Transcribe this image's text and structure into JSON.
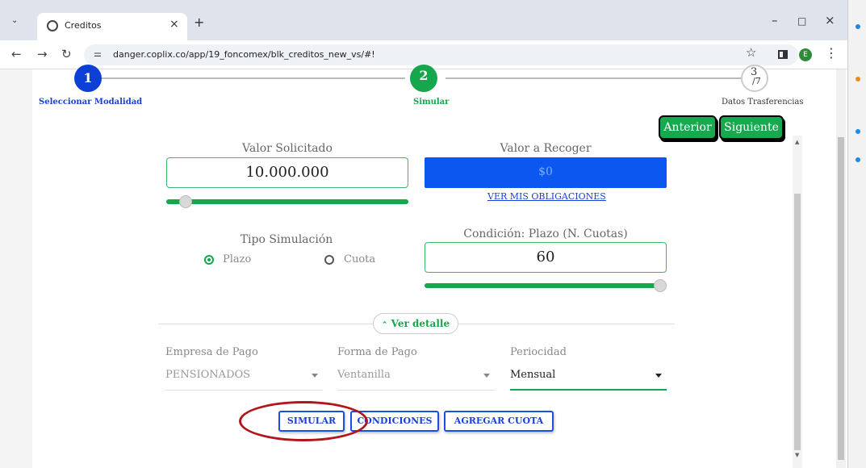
{
  "browser": {
    "tab_title": "Creditos",
    "url": "danger.coplix.co/app/19_foncomex/blk_creditos_new_vs/#!",
    "profile_initial": "E"
  },
  "stepper": {
    "steps": [
      {
        "number": "1",
        "label": "Seleccionar Modalidad",
        "state": "done",
        "color": "#0b3fd6"
      },
      {
        "number": "2",
        "label": "Simular",
        "state": "active",
        "color": "#16a64c"
      },
      {
        "number": "3",
        "total": "/7",
        "label": "Datos Trasferencias",
        "state": "pending"
      }
    ]
  },
  "nav": {
    "anterior": "Anterior",
    "siguiente": "Siguiente"
  },
  "form": {
    "valor_solicitado": {
      "label": "Valor Solicitado",
      "value": "10.000.000",
      "slider_fraction": 0.08
    },
    "valor_recoger": {
      "label": "Valor a Recoger",
      "value": "$0",
      "link": "VER MIS OBLIGACIONES"
    },
    "tipo_simulacion": {
      "label": "Tipo Simulación",
      "options": [
        "Plazo",
        "Cuota"
      ],
      "selected": "Plazo"
    },
    "condicion_plazo": {
      "label": "Condición: Plazo (N. Cuotas)",
      "value": "60",
      "slider_fraction": 1.0
    },
    "ver_detalle": "Ver detalle",
    "empresa_pago": {
      "label": "Empresa de Pago",
      "value": "PENSIONADOS"
    },
    "forma_pago": {
      "label": "Forma de Pago",
      "value": "Ventanilla"
    },
    "periodicidad": {
      "label": "Periocidad",
      "value": "Mensual"
    }
  },
  "actions": {
    "simular": "SIMULAR",
    "condiciones": "CONDICIONES",
    "agregar_cuota": "AGREGAR CUOTA"
  },
  "colors": {
    "primary_green": "#16a64c",
    "primary_blue": "#0b57f0",
    "annotation_red": "#b2151b"
  }
}
